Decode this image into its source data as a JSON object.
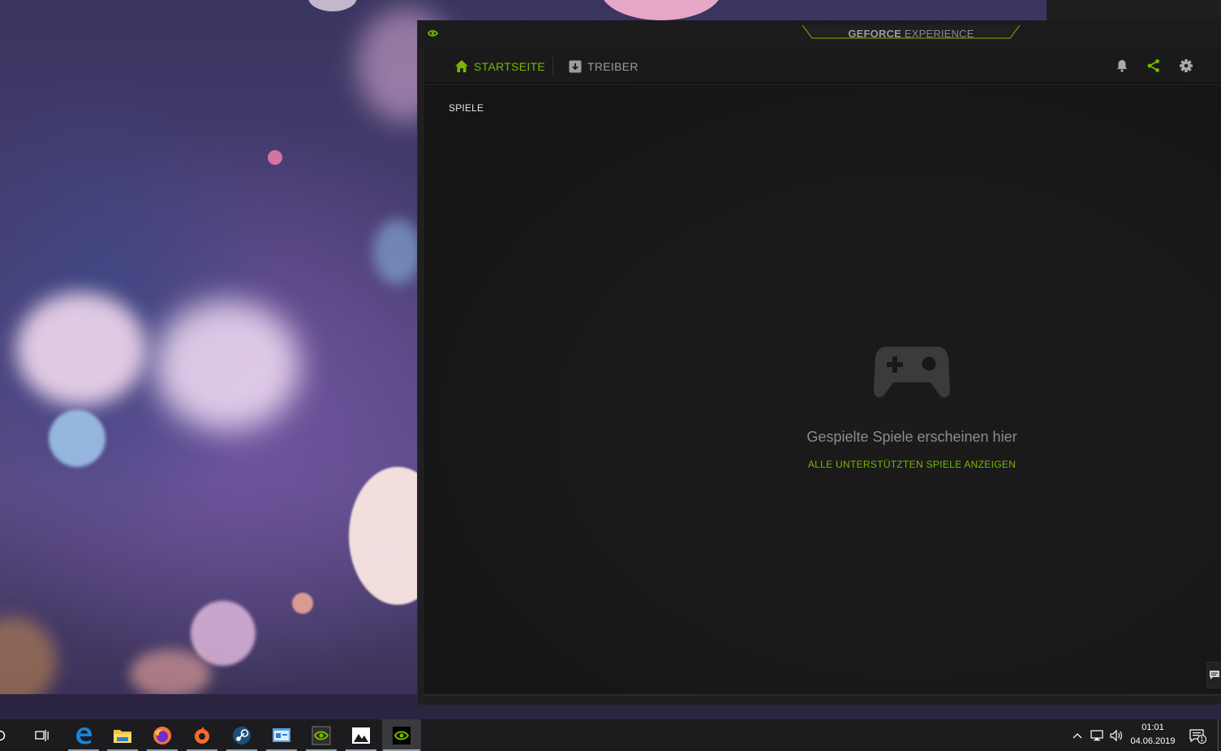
{
  "window": {
    "brand_bold": "GEFORCE",
    "brand_light": " EXPERIENCE"
  },
  "nav": {
    "tabs": [
      {
        "label": "STARTSEITE",
        "active": true,
        "icon": "home-icon"
      },
      {
        "label": "TREIBER",
        "active": false,
        "icon": "driver-icon"
      }
    ],
    "actions": [
      "bell-icon",
      "share-icon",
      "gear-icon"
    ]
  },
  "content": {
    "section_title": "SPIELE",
    "empty_state": {
      "icon": "gamepad-icon",
      "message": "Gespielte Spiele erscheinen hier",
      "link": "ALLE UNTERSTÜTZTEN SPIELE ANZEIGEN"
    }
  },
  "taskbar": {
    "apps": [
      "search-icon",
      "task-view-icon",
      "edge-icon",
      "file-explorer-icon",
      "firefox-icon",
      "origin-icon",
      "steam-icon",
      "control-panel-icon",
      "nvidia-control-icon",
      "photos-icon",
      "geforce-experience-icon"
    ],
    "tray": {
      "time": "01:01",
      "date": "04.06.2019",
      "notification_count": "1"
    }
  },
  "colors": {
    "accent": "#76b900",
    "window_bg": "#1f1f1f",
    "taskbar_bg": "#1c1c1e"
  }
}
